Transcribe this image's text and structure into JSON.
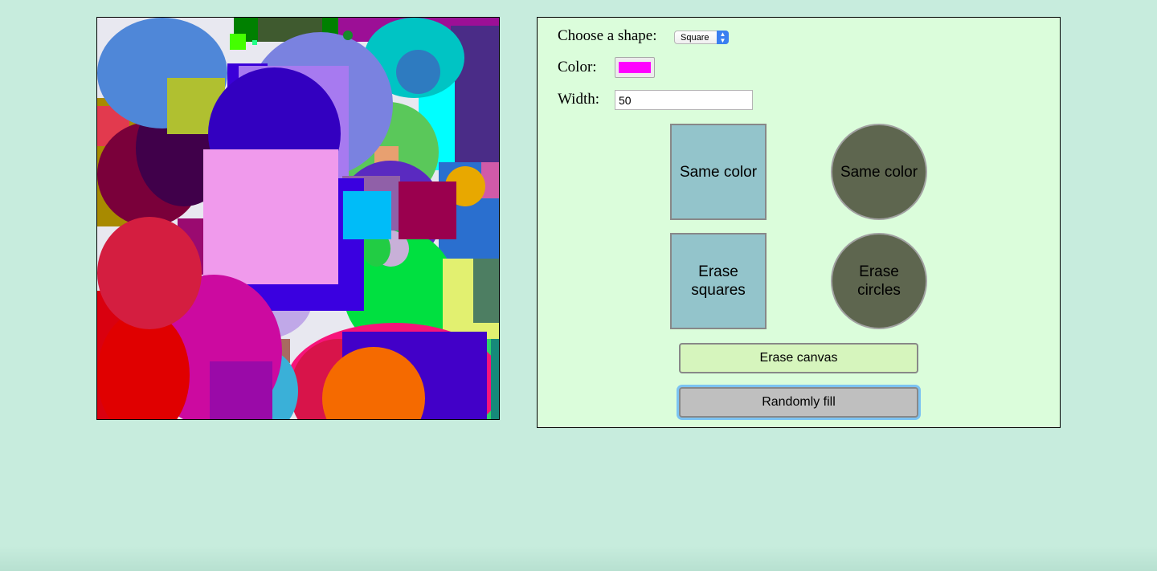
{
  "controls": {
    "shape_label": "Choose a shape:",
    "shape_value": "Square",
    "color_label": "Color:",
    "color_value": "#ff00ff",
    "width_label": "Width:",
    "width_value": "50"
  },
  "buttons": {
    "same_color_square": "Same color",
    "same_color_circle": "Same color",
    "erase_squares": "Erase squares",
    "erase_circles": "Erase circles",
    "erase_canvas": "Erase canvas",
    "randomly_fill": "Randomly fill"
  },
  "colors": {
    "page_background": "#c7ecdd",
    "panel_background": "#dbfddb",
    "square_button": "#93c4cb",
    "circle_button": "#5e664f",
    "erase_canvas_button": "#d6f5bd",
    "randomly_fill_button": "#bfbfbf",
    "focus_ring": "#7cc3f2"
  },
  "icons": {
    "select_arrows": "updown-chevron-icon"
  }
}
